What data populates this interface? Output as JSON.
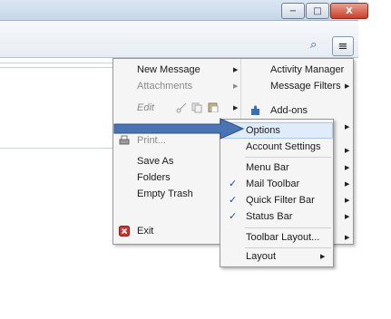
{
  "icons": {
    "minimize": "minimize-icon",
    "maximize": "maximize-icon",
    "close": "close-icon",
    "search": "search-icon",
    "menu": "hamburger-menu-icon",
    "print": "printer-icon",
    "exit": "exit-icon",
    "addons": "puzzle-icon",
    "cut": "cut-icon",
    "copy": "copy-icon",
    "paste": "paste-icon",
    "pointer": "pointer-arrow"
  },
  "colors": {
    "arrow_fill": "#4a74b4",
    "arrow_stroke": "#2c4f86",
    "highlight": "#e1ecfa",
    "exit_icon": "#d2312a"
  },
  "window": {
    "minimize": "−",
    "maximize": "□",
    "close": "X"
  },
  "search_glyph": "⌕",
  "menu_glyph": "≡",
  "app_menu": {
    "left": {
      "new_message": "New Message",
      "attachments": "Attachments",
      "edit": "Edit",
      "print": "Print...",
      "save_as": "Save As",
      "folders": "Folders",
      "empty_trash": "Empty Trash",
      "exit": "Exit"
    },
    "right": {
      "activity_manager": "Activity Manager",
      "message_filters": "Message Filters",
      "add_ons": "Add-ons"
    }
  },
  "options_submenu": {
    "options": "Options",
    "account_settings": "Account Settings",
    "menu_bar": "Menu Bar",
    "mail_toolbar": "Mail Toolbar",
    "quick_filter_bar": "Quick Filter Bar",
    "status_bar": "Status Bar",
    "toolbar_layout": "Toolbar Layout...",
    "layout": "Layout",
    "checked": [
      "mail_toolbar",
      "quick_filter_bar",
      "status_bar"
    ],
    "highlighted": "options",
    "check_glyph": "✓"
  },
  "arrow_glyph": "▶"
}
